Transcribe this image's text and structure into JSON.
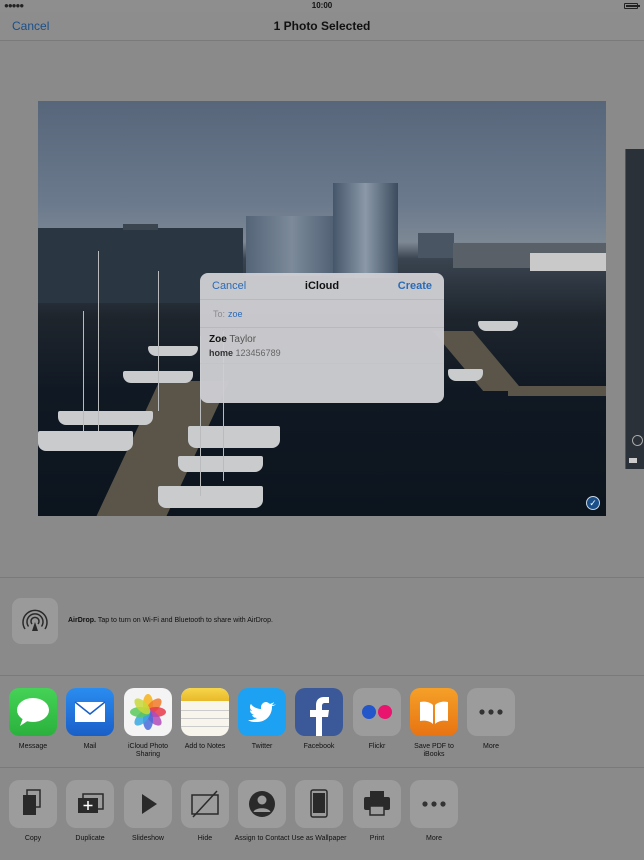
{
  "status": {
    "time": "10:00",
    "signal": "●●●●●"
  },
  "nav": {
    "cancel": "Cancel",
    "title": "1 Photo Selected"
  },
  "dialog": {
    "cancel": "Cancel",
    "title": "iCloud",
    "create": "Create",
    "to_label": "To:",
    "to_value": "zoe",
    "contact": {
      "first": "Zoe",
      "last": "Taylor",
      "kind": "home",
      "number": "123456789"
    }
  },
  "airdrop": {
    "title": "AirDrop.",
    "text": " Tap to turn on Wi-Fi and Bluetooth to share with AirDrop."
  },
  "share_apps": [
    {
      "label": "Message",
      "icon": "message-icon"
    },
    {
      "label": "Mail",
      "icon": "mail-icon"
    },
    {
      "label": "iCloud Photo Sharing",
      "icon": "icloud-photo-sharing-icon"
    },
    {
      "label": "Add to Notes",
      "icon": "notes-icon"
    },
    {
      "label": "Twitter",
      "icon": "twitter-icon"
    },
    {
      "label": "Facebook",
      "icon": "facebook-icon"
    },
    {
      "label": "Flickr",
      "icon": "flickr-icon"
    },
    {
      "label": "Save PDF to iBooks",
      "icon": "ibooks-icon"
    },
    {
      "label": "More",
      "icon": "more-icon"
    }
  ],
  "actions": [
    {
      "label": "Copy",
      "icon": "copy-icon"
    },
    {
      "label": "Duplicate",
      "icon": "duplicate-icon"
    },
    {
      "label": "Slideshow",
      "icon": "slideshow-icon"
    },
    {
      "label": "Hide",
      "icon": "hide-icon"
    },
    {
      "label": "Assign to Contact",
      "icon": "assign-contact-icon"
    },
    {
      "label": "Use as Wallpaper",
      "icon": "wallpaper-icon"
    },
    {
      "label": "Print",
      "icon": "print-icon"
    },
    {
      "label": "More",
      "icon": "more-icon"
    }
  ],
  "colors": {
    "accent": "#2a6bb8",
    "twitter": "#1da1f2",
    "facebook": "#3b5998",
    "messages": "#3ac44a",
    "ibooks": "#f08a1c"
  }
}
